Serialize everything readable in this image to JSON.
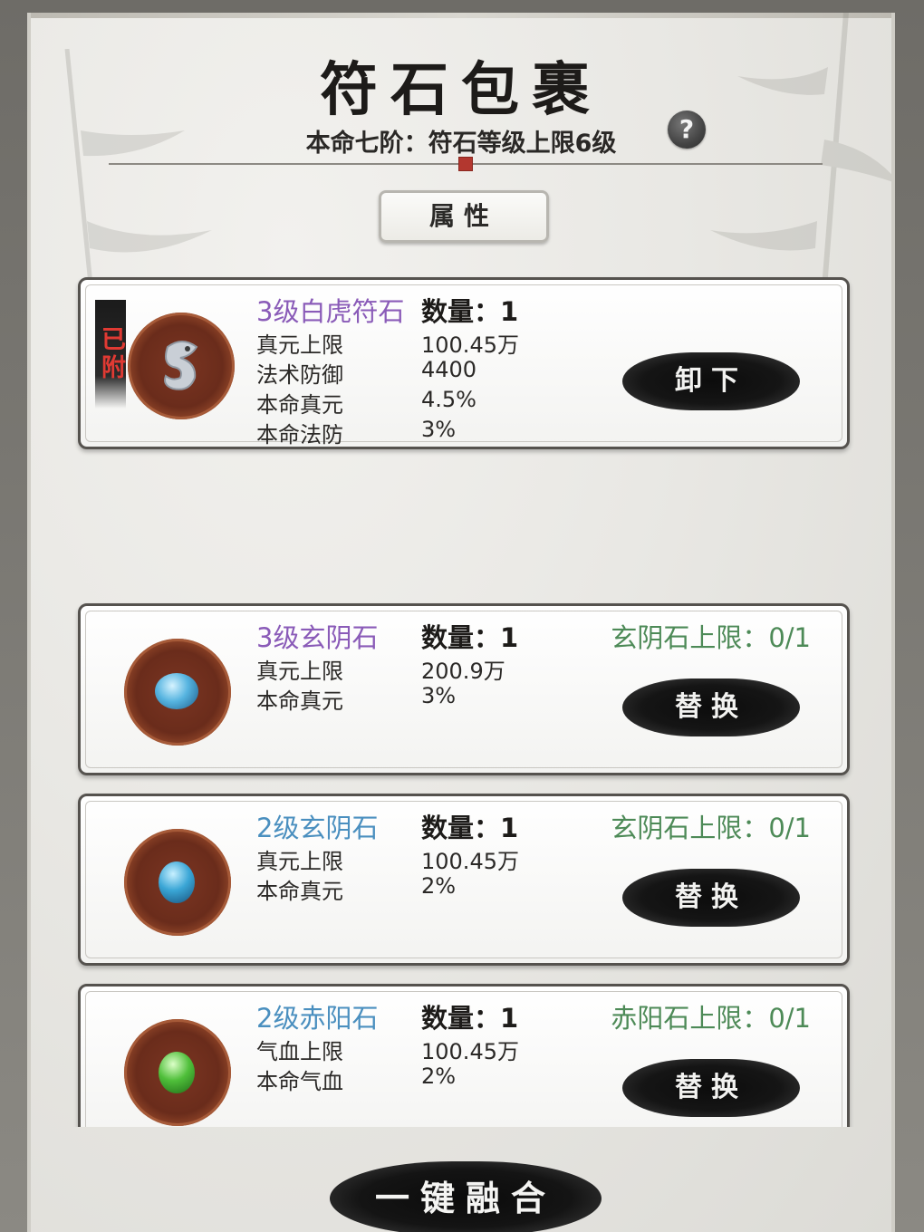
{
  "header": {
    "title": "符石包裹",
    "subtitle": "本命七阶：符石等级上限6级",
    "help_label": "?"
  },
  "tabs": {
    "attributes_label": "属性"
  },
  "equipped": {
    "tag": "已附",
    "name": "3级白虎符石",
    "name_color": "#8a5bb8",
    "count_label": "数量：1",
    "stats": [
      {
        "label": "真元上限",
        "value": "100.45万"
      },
      {
        "label": "法术防御",
        "value": "4400"
      },
      {
        "label": "本命真元",
        "value": "4.5%"
      },
      {
        "label": "本命法防",
        "value": "3%"
      }
    ],
    "button_label": "卸下",
    "icon": "white-tiger-icon"
  },
  "items": [
    {
      "name": "3级玄阴石",
      "name_color": "#8a5bb8",
      "count_label": "数量：1",
      "limit_label": "玄阴石上限：0/1",
      "stats": [
        {
          "label": "真元上限",
          "value": "200.9万"
        },
        {
          "label": "本命真元",
          "value": "3%"
        }
      ],
      "button_label": "替换",
      "gem_color": "#56b4e0",
      "icon": "blue-orb-icon"
    },
    {
      "name": "2级玄阴石",
      "name_color": "#4a8fbf",
      "count_label": "数量：1",
      "limit_label": "玄阴石上限：0/1",
      "stats": [
        {
          "label": "真元上限",
          "value": "100.45万"
        },
        {
          "label": "本命真元",
          "value": "2%"
        }
      ],
      "button_label": "替换",
      "gem_color": "#3aa6d6",
      "icon": "blue-gem-icon"
    },
    {
      "name": "2级赤阳石",
      "name_color": "#4a8fbf",
      "count_label": "数量：1",
      "limit_label": "赤阳石上限：0/1",
      "stats": [
        {
          "label": "气血上限",
          "value": "100.45万"
        },
        {
          "label": "本命气血",
          "value": "2%"
        }
      ],
      "button_label": "替换",
      "gem_color": "#4fbf3a",
      "icon": "green-gem-icon"
    }
  ],
  "footer": {
    "fuse_all_label": "一键融合"
  }
}
